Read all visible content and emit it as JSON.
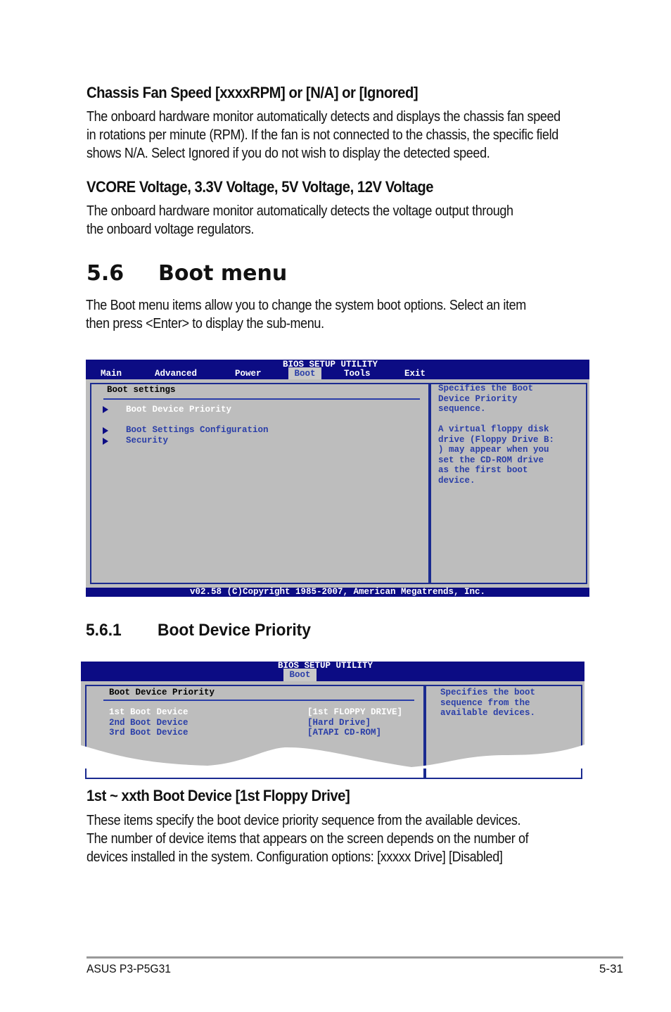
{
  "sections": [
    {
      "heading": "Chassis Fan Speed [xxxxRPM] or [N/A] or [Ignored]",
      "lines": [
        "The onboard hardware monitor automatically detects and displays the chassis fan speed",
        "in rotations per minute (RPM). If the fan is not connected to the chassis, the specific field",
        "shows N/A. Select Ignored if you do not wish to display the detected speed."
      ]
    },
    {
      "heading": "VCORE Voltage, 3.3V Voltage, 5V Voltage, 12V Voltage",
      "lines": [
        "The onboard hardware monitor automatically detects the voltage output through",
        "the onboard voltage regulators."
      ]
    }
  ],
  "boot_menu": {
    "number": "5.6",
    "title": "Boot menu",
    "lines": [
      "The Boot menu items allow you to change the system boot options. Select an item",
      "then press <Enter> to display the sub-menu."
    ]
  },
  "bios1": {
    "title": "BIOS SETUP UTILITY",
    "tabs": [
      "Main",
      "Advanced",
      "Power",
      "Boot",
      "Tools",
      "Exit"
    ],
    "active_tab": "Boot",
    "section_title": "Boot settings",
    "items": [
      "Boot Device Priority",
      "Boot Settings Configuration",
      "Security"
    ],
    "help": [
      "Specifies the Boot",
      "Device Priority",
      "sequence.",
      "",
      "A virtual floppy disk",
      "drive (Floppy Drive B:",
      ") may appear when you",
      "set the CD-ROM drive",
      "as the first boot",
      "device."
    ],
    "footer": "v02.58 (C)Copyright 1985-2007, American Megatrends, Inc.",
    "colors": {
      "header": "#0c0c84",
      "body": "#bdbdbd",
      "text": "#2a3ea8"
    }
  },
  "subsection": {
    "number": "5.6.1",
    "title": "Boot Device Priority"
  },
  "bios2": {
    "title": "BIOS SETUP UTILITY",
    "active_tab": "Boot",
    "section_title": "Boot Device Priority",
    "rows": [
      {
        "label": "1st Boot Device",
        "value": "[1st FLOPPY DRIVE]"
      },
      {
        "label": "2nd Boot Device",
        "value": "[Hard Drive]"
      },
      {
        "label": "3rd Boot Device",
        "value": "[ATAPI CD-ROM]"
      }
    ],
    "help": [
      "Specifies the boot",
      "sequence from the",
      "available devices."
    ]
  },
  "option": {
    "heading": "1st ~ xxth Boot Device [1st Floppy Drive]",
    "lines": [
      "These items specify the boot device priority sequence from the available devices.",
      "The number of device items that appears on the screen depends on the number of",
      "devices installed in the system. Configuration options: [xxxxx Drive] [Disabled]"
    ]
  },
  "footer": {
    "left": "ASUS P3-P5G31",
    "right": "5-31"
  }
}
